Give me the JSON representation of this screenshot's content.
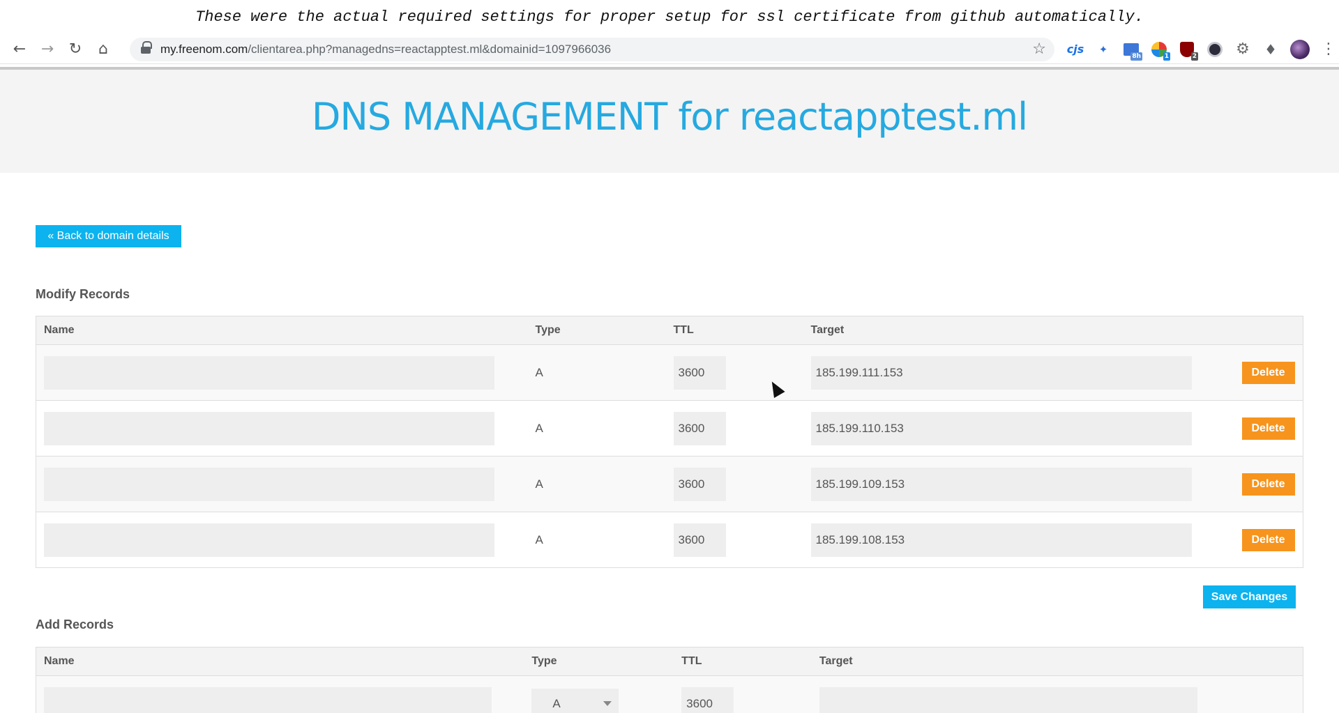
{
  "caption": "These were the actual required settings for proper setup for ssl certificate from github automatically.",
  "browser": {
    "url_host": "my.freenom.com",
    "url_rest": "/clientarea.php?managedns=reactapptest.ml&domainid=1097966036",
    "extensions": [
      {
        "name": "cjs",
        "label": "cjs"
      },
      {
        "name": "pin",
        "label": ""
      },
      {
        "name": "calendar",
        "badge": "8h"
      },
      {
        "name": "s-ext",
        "badge": "1"
      },
      {
        "name": "ublock",
        "badge": "2"
      },
      {
        "name": "ghost",
        "badge": ""
      }
    ]
  },
  "page": {
    "title": "DNS MANAGEMENT for reactapptest.ml",
    "back_button": "« Back to domain details",
    "modify_title": "Modify Records",
    "add_title": "Add Records",
    "save_button": "Save Changes",
    "delete_label": "Delete"
  },
  "columns": {
    "name": "Name",
    "type": "Type",
    "ttl": "TTL",
    "target": "Target"
  },
  "records": [
    {
      "name": "",
      "type": "A",
      "ttl": "3600",
      "target": "185.199.111.153"
    },
    {
      "name": "",
      "type": "A",
      "ttl": "3600",
      "target": "185.199.110.153"
    },
    {
      "name": "",
      "type": "A",
      "ttl": "3600",
      "target": "185.199.109.153"
    },
    {
      "name": "",
      "type": "A",
      "ttl": "3600",
      "target": "185.199.108.153"
    }
  ],
  "new_record": {
    "name": "",
    "type": "A",
    "ttl": "3600",
    "target": ""
  }
}
